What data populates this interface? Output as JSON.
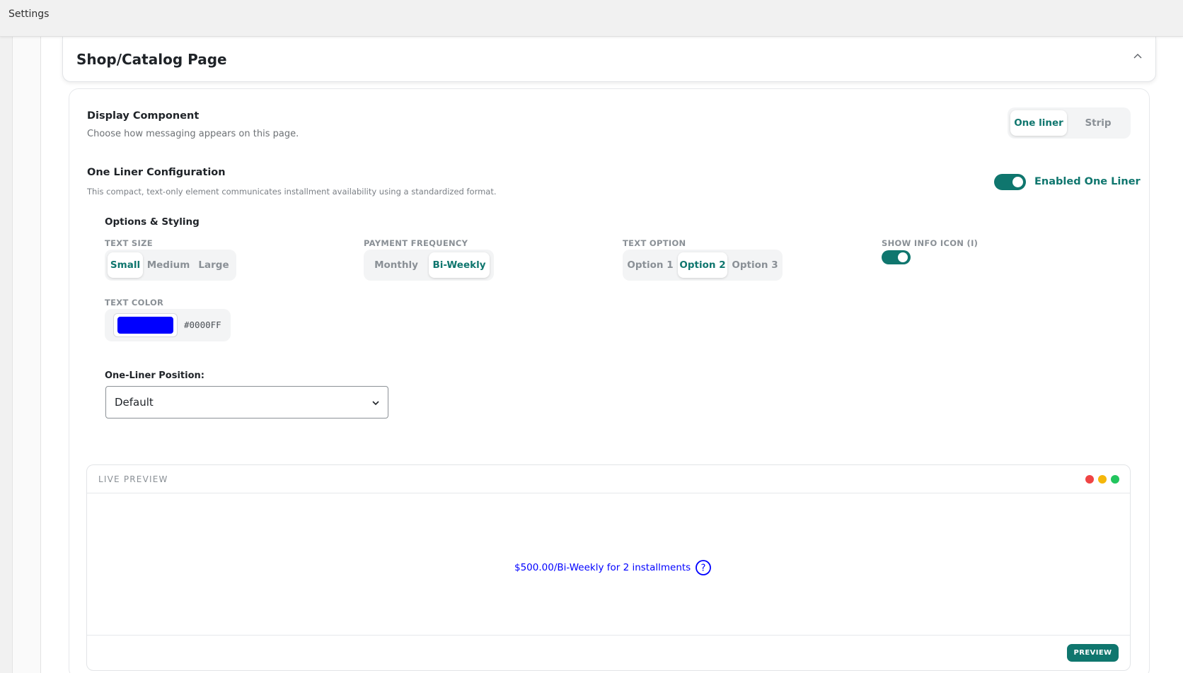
{
  "topbar": {
    "title": "Settings"
  },
  "section": {
    "title": "Shop/Catalog Page",
    "collapse_icon": "chevron-up-icon"
  },
  "display_component": {
    "title": "Display Component",
    "description": "Choose how messaging appears on this page.",
    "options": [
      "One liner",
      "Strip"
    ],
    "selected": "One liner"
  },
  "one_liner": {
    "title": "One Liner Configuration",
    "description": "This compact, text-only element communicates installment availability using a standardized format.",
    "toggle_label": "Enabled One Liner",
    "enabled": true
  },
  "options_styling": {
    "title": "Options & Styling",
    "text_size": {
      "label": "TEXT SIZE",
      "options": [
        "Small",
        "Medium",
        "Large"
      ],
      "selected": "Small"
    },
    "payment_frequency": {
      "label": "PAYMENT FREQUENCY",
      "options": [
        "Monthly",
        "Bi-Weekly"
      ],
      "selected": "Bi-Weekly"
    },
    "text_option": {
      "label": "TEXT OPTION",
      "options": [
        "Option 1",
        "Option 2",
        "Option 3"
      ],
      "selected": "Option 2"
    },
    "show_info_icon": {
      "label": "SHOW INFO ICON (I)",
      "enabled": true
    },
    "text_color": {
      "label": "TEXT COLOR",
      "value": "#0000FF"
    }
  },
  "position": {
    "label": "One-Liner Position:",
    "value": "Default"
  },
  "live_preview": {
    "title": "LIVE PREVIEW",
    "message": "$500.00/Bi-Weekly for 2 installments",
    "info_icon": "question-circle-icon",
    "window_dots": [
      "#ef4444",
      "#f5b70a",
      "#22c55e"
    ],
    "button_label": "PREVIEW"
  },
  "colors": {
    "accent": "#0f766e",
    "text_color": "#0000FF"
  }
}
